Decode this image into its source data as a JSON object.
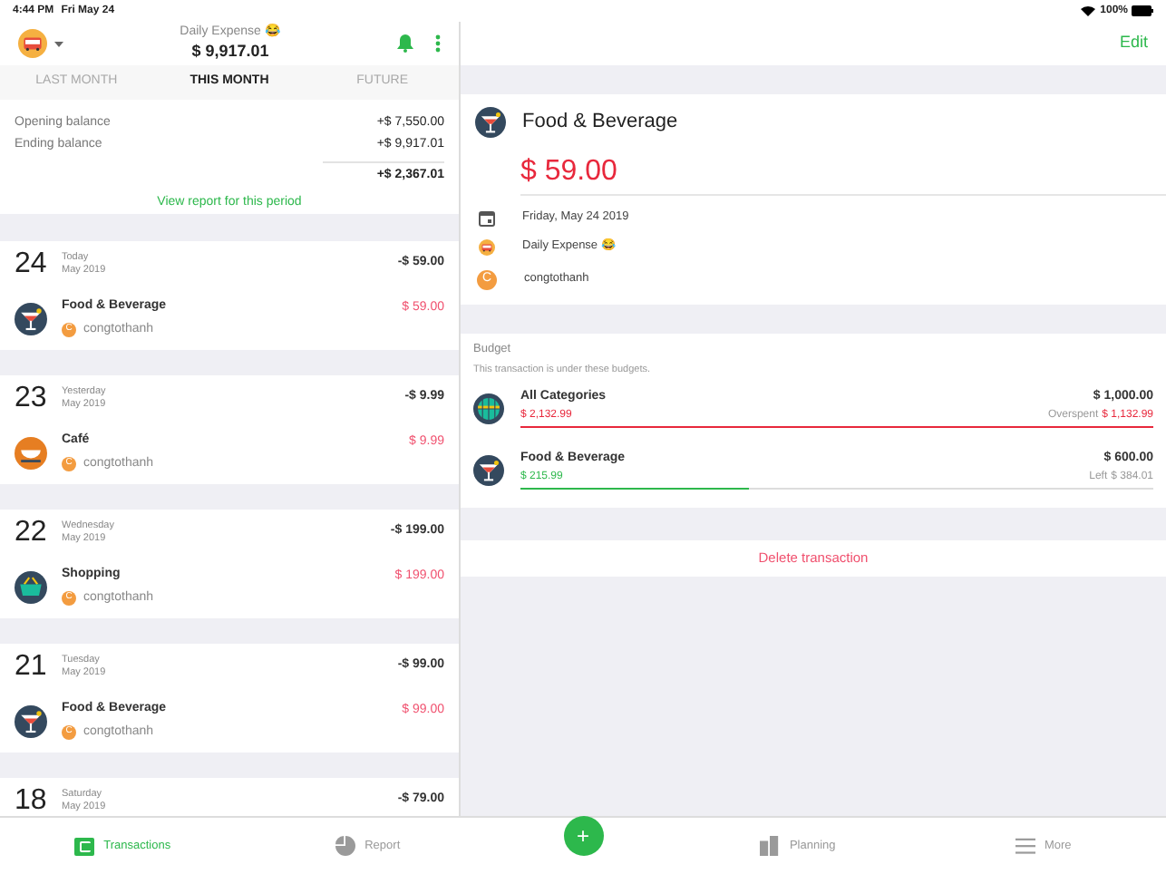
{
  "status_bar": {
    "time": "4:44 PM",
    "date": "Fri May 24",
    "battery": "100%"
  },
  "header": {
    "wallet_name": "Daily Expense 😂",
    "balance": "$ 9,917.01"
  },
  "tabs": [
    {
      "label": "LAST MONTH",
      "selected": false
    },
    {
      "label": "THIS MONTH",
      "selected": true
    },
    {
      "label": "FUTURE",
      "selected": false
    }
  ],
  "summary": {
    "rows": [
      {
        "label": "Opening balance",
        "value": "+$ 7,550.00"
      },
      {
        "label": "Ending balance",
        "value": "+$ 9,917.01"
      }
    ],
    "total": "+$ 2,367.01",
    "report_link": "View report for this period"
  },
  "days": [
    {
      "day": "24",
      "weekday": "Today",
      "month": "May 2019",
      "total": "-$ 59.00",
      "transactions": [
        {
          "kind": "drink",
          "category": "Food & Beverage",
          "avatar_letter": "C",
          "user": "congtothanh",
          "amount": "$ 59.00"
        }
      ]
    },
    {
      "day": "23",
      "weekday": "Yesterday",
      "month": "May 2019",
      "total": "-$ 9.99",
      "transactions": [
        {
          "kind": "cafe",
          "category": "Café",
          "avatar_letter": "C",
          "user": "congtothanh",
          "amount": "$ 9.99"
        }
      ]
    },
    {
      "day": "22",
      "weekday": "Wednesday",
      "month": "May 2019",
      "total": "-$ 199.00",
      "transactions": [
        {
          "kind": "basket",
          "category": "Shopping",
          "avatar_letter": "C",
          "user": "congtothanh",
          "amount": "$ 199.00"
        }
      ]
    },
    {
      "day": "21",
      "weekday": "Tuesday",
      "month": "May 2019",
      "total": "-$ 99.00",
      "transactions": [
        {
          "kind": "drink",
          "category": "Food & Beverage",
          "avatar_letter": "C",
          "user": "congtothanh",
          "amount": "$ 99.00"
        }
      ]
    },
    {
      "day": "18",
      "weekday": "Saturday",
      "month": "May 2019",
      "total": "-$ 79.00"
    }
  ],
  "detail": {
    "edit": "Edit",
    "kind": "drink",
    "category": "Food & Beverage",
    "amount": "$ 59.00",
    "date": "Friday, May 24 2019",
    "wallet": "Daily Expense 😂",
    "avatar_letter": "C",
    "user": "congtothanh",
    "budget_title": "Budget",
    "budget_note": "This transaction is under these budgets.",
    "budgets": [
      {
        "kind": "globe",
        "name": "All Categories",
        "spent": "$ 2,132.99",
        "limit": "$ 1,000.00",
        "status_label": "Overspent",
        "status_value": "$ 1,132.99",
        "overspent": true,
        "level": 1
      },
      {
        "kind": "drink",
        "name": "Food & Beverage",
        "spent": "$ 215.99",
        "limit": "$ 600.00",
        "status_label": "Left",
        "status_value": "$ 384.01",
        "overspent": false,
        "level": 0.36
      }
    ],
    "delete": "Delete transaction"
  },
  "bottom_nav": [
    {
      "kind": "wallet",
      "label": "Transactions",
      "selected": true
    },
    {
      "kind": "report",
      "label": "Report",
      "selected": false
    },
    {
      "kind": "add",
      "label": "+"
    },
    {
      "kind": "planning",
      "label": "Planning",
      "selected": false
    },
    {
      "kind": "more",
      "label": "More",
      "selected": false
    }
  ]
}
